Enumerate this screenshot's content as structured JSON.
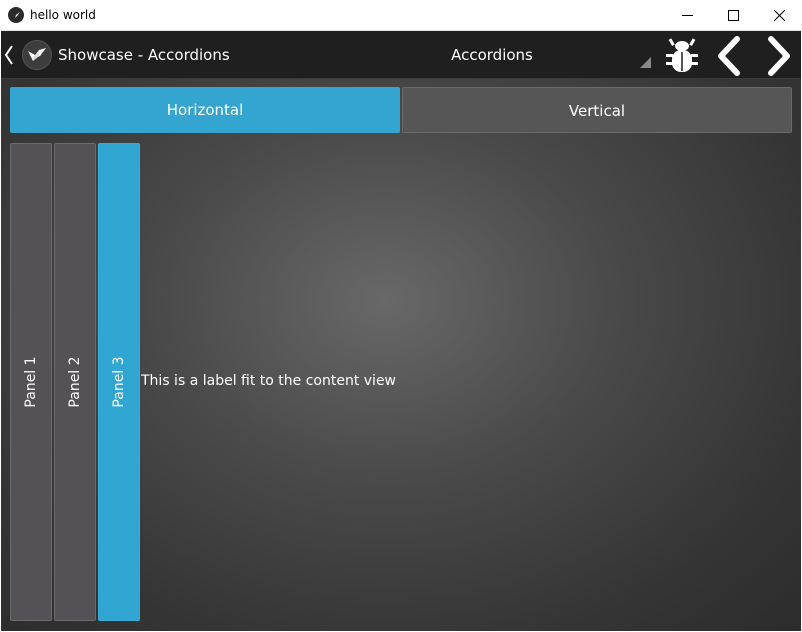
{
  "window": {
    "title": "hello world",
    "icons": {
      "app": "kivy-icon",
      "minimize": "minimize-icon",
      "maximize": "maximize-icon",
      "close": "close-icon"
    }
  },
  "actionbar": {
    "title": "Showcase - Accordions",
    "spinner_value": "Accordions",
    "icons": {
      "back": "chevron-left-icon",
      "logo": "kivy-logo-icon",
      "dropdown": "dropdown-triangle-icon",
      "bug": "bug-icon",
      "prev": "chevron-left-icon",
      "next": "chevron-right-icon"
    }
  },
  "tabs": [
    {
      "label": "Horizontal",
      "selected": true
    },
    {
      "label": "Vertical",
      "selected": false
    }
  ],
  "accordion": {
    "panels": [
      {
        "title": "Panel 1",
        "selected": false
      },
      {
        "title": "Panel 2",
        "selected": false
      },
      {
        "title": "Panel 3",
        "selected": true
      }
    ],
    "content": "This is a label fit to the content view"
  },
  "colors": {
    "accent": "#33a5d0",
    "actionbar": "#1f1f1f",
    "panel": "#545256",
    "text": "#ffffff"
  }
}
